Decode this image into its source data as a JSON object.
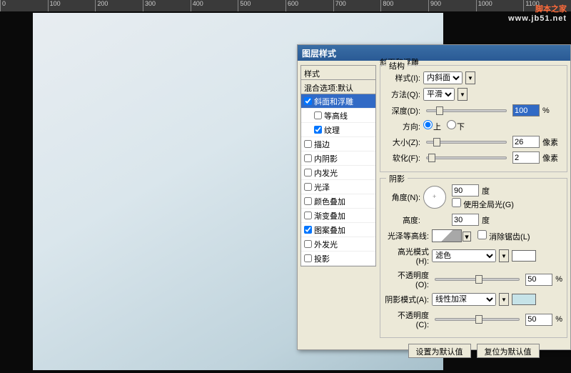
{
  "watermark": {
    "name": "脚本之家",
    "url": "www.jb51.net"
  },
  "ruler": [
    "0",
    "100",
    "200",
    "300",
    "400",
    "500",
    "600",
    "700",
    "800",
    "900",
    "1000",
    "1100"
  ],
  "dialog": {
    "title": "图层样式",
    "panel_title": "斜面和浮雕",
    "stylelist": {
      "styles_header": "样式",
      "blend_default": "混合选项:默认",
      "items": [
        {
          "label": "斜面和浮雕",
          "checked": true,
          "selected": true,
          "indent": false
        },
        {
          "label": "等高线",
          "checked": false,
          "selected": false,
          "indent": true
        },
        {
          "label": "纹理",
          "checked": true,
          "selected": false,
          "indent": true
        },
        {
          "label": "描边",
          "checked": false,
          "selected": false,
          "indent": false
        },
        {
          "label": "内阴影",
          "checked": false,
          "selected": false,
          "indent": false
        },
        {
          "label": "内发光",
          "checked": false,
          "selected": false,
          "indent": false
        },
        {
          "label": "光泽",
          "checked": false,
          "selected": false,
          "indent": false
        },
        {
          "label": "颜色叠加",
          "checked": false,
          "selected": false,
          "indent": false
        },
        {
          "label": "渐变叠加",
          "checked": false,
          "selected": false,
          "indent": false
        },
        {
          "label": "图案叠加",
          "checked": true,
          "selected": false,
          "indent": false
        },
        {
          "label": "外发光",
          "checked": false,
          "selected": false,
          "indent": false
        },
        {
          "label": "投影",
          "checked": false,
          "selected": false,
          "indent": false
        }
      ]
    },
    "structure": {
      "legend": "结构",
      "style_label": "样式(I):",
      "style_value": "内斜面",
      "method_label": "方法(Q):",
      "method_value": "平滑",
      "depth_label": "深度(D):",
      "depth_value": "100",
      "depth_unit": "%",
      "direction_label": "方向:",
      "dir_up": "上",
      "dir_down": "下",
      "size_label": "大小(Z):",
      "size_value": "26",
      "size_unit": "像素",
      "soften_label": "软化(F):",
      "soften_value": "2",
      "soften_unit": "像素"
    },
    "shadow": {
      "legend": "阴影",
      "angle_label": "角度(N):",
      "angle_value": "90",
      "angle_unit": "度",
      "global_light": "使用全局光(G)",
      "altitude_label": "高度:",
      "altitude_value": "30",
      "altitude_unit": "度",
      "gloss_label": "光泽等高线:",
      "antialias": "消除锯齿(L)",
      "highlight_mode_label": "高光模式(H):",
      "highlight_mode": "滤色",
      "opacity_label": "不透明度(O):",
      "highlight_opacity": "50",
      "opacity_unit": "%",
      "shadow_mode_label": "阴影模式(A):",
      "shadow_mode": "线性加深",
      "opacity2_label": "不透明度(C):",
      "shadow_opacity": "50"
    },
    "buttons": {
      "default": "设置为默认值",
      "reset": "复位为默认值"
    }
  }
}
